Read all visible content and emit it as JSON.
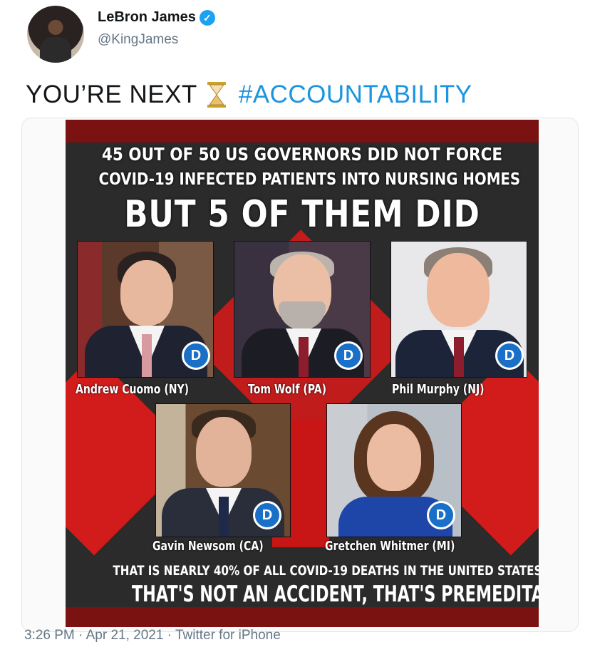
{
  "author": {
    "name": "LeBron James",
    "handle": "@KingJames",
    "verified_icon": "verified-badge-icon"
  },
  "tweet": {
    "text_before": "YOU’RE NEXT",
    "emoji": "hourglass-icon",
    "hashtag": "#ACCOUNTABILITY"
  },
  "image": {
    "headline_line1": "45 OUT OF 50 US GOVERNORS DID NOT FORCE",
    "headline_line2": "COVID-19 INFECTED PATIENTS INTO NURSING HOMES",
    "headline_big": "BUT 5 OF THEM DID",
    "badge_letter": "D",
    "governors": [
      {
        "caption": "Andrew Cuomo (NY)"
      },
      {
        "caption": "Tom Wolf (PA)"
      },
      {
        "caption": "Phil Murphy (NJ)"
      },
      {
        "caption": "Gavin Newsom (CA)"
      },
      {
        "caption": "Gretchen Whitmer (MI)"
      }
    ],
    "stat_line1": "THAT IS NEARLY 40% OF ALL COVID-19 DEATHS IN THE UNITED STATES",
    "stat_line2": "THAT'S NOT AN ACCIDENT, THAT'S PREMEDITATED MURDER!",
    "colors": {
      "accent_red": "#d21b1b",
      "dark_bg": "#2b2b2b",
      "badge_blue": "#1a6fc7"
    }
  },
  "meta": {
    "timestamp": "3:26 PM · Apr 21, 2021 · Twitter for iPhone"
  },
  "colors": {
    "link_blue": "#1b95e0",
    "verified_blue": "#1da1f2",
    "muted_gray": "#657786"
  }
}
